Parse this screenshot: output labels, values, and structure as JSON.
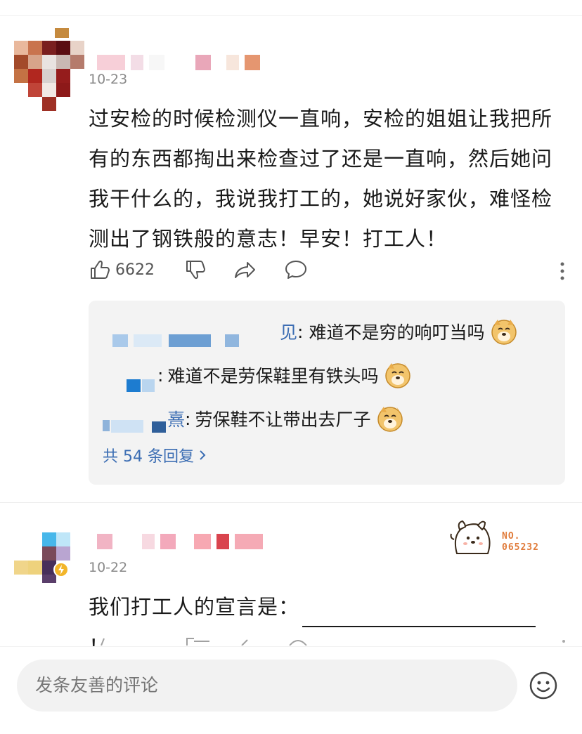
{
  "comments": [
    {
      "date": "10-23",
      "text": "过安检的时候检测仪一直响，安检的姐姐让我把所有的东西都掏出来检查过了还是一直响，然后她问我干什么的，我说我打工的，她说好家伙，难怪检测出了钢铁般的意志！早安！打工人！",
      "text_lines": [
        "过安检的时候检测仪一直响，安检的姐姐让我把所",
        "有的东西都掏出来检查过了还是一直响，然后她问",
        "我干什么的，我说我打工的，她说好家伙，难怪检",
        "测出了钢铁般的意志！早安！打工人！"
      ],
      "likes": "6622",
      "replies": [
        {
          "name_tail": "见",
          "sep": ":",
          "text": "难道不是穷的响叮当吗",
          "emoji": "doge-emoji"
        },
        {
          "name_tail": "",
          "sep": ":",
          "text": "难道不是劳保鞋里有铁头吗",
          "emoji": "doge-emoji"
        },
        {
          "name_tail": "熹",
          "sep": ":",
          "text": "劳保鞋不让带出去厂子",
          "emoji": "doge-emoji"
        }
      ],
      "more_replies": "共 54 条回复",
      "more_replies_icon": "chevron-right-icon"
    },
    {
      "date": "10-22",
      "text_before": "我们打工人的宣言是：",
      "text_after": "！",
      "badge_icon": "verified-lightning-icon"
    }
  ],
  "sticker": {
    "line1": "NO.",
    "line2": "065232"
  },
  "composer": {
    "placeholder": "发条友善的评论",
    "emoji_icon": "smiley-icon"
  },
  "icons": {
    "like": "thumbs-up-icon",
    "dislike": "thumbs-down-icon",
    "share": "share-arrow-icon",
    "comment": "speech-bubble-icon",
    "more": "more-vertical-icon"
  },
  "colors": {
    "link_blue": "#3b6db3",
    "reply_bg": "#f3f3f3",
    "muted": "#8a8a8a",
    "sticker_orange": "#e07b3a"
  }
}
